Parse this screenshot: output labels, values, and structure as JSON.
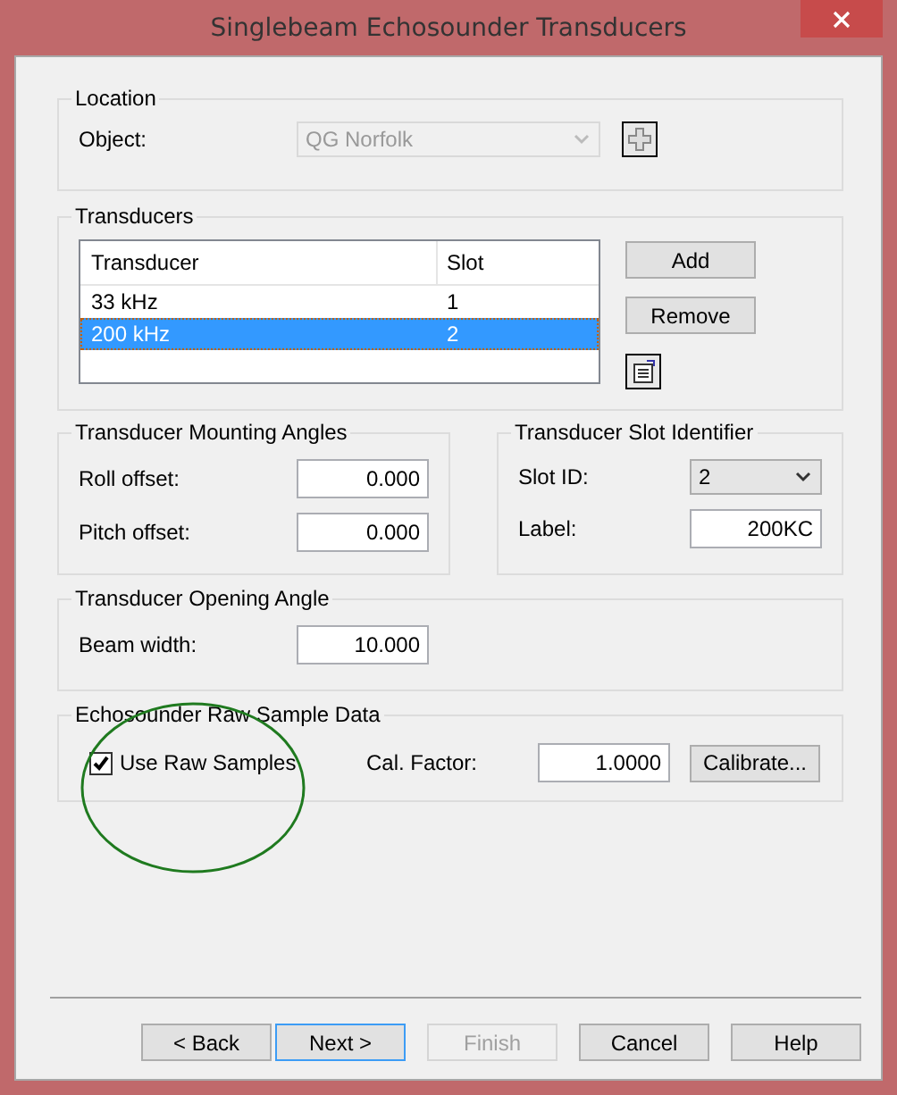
{
  "window": {
    "title": "Singlebeam Echosounder Transducers"
  },
  "location": {
    "title": "Location",
    "label": "Object:",
    "value": "QG Norfolk",
    "disabled": true
  },
  "transducers": {
    "title": "Transducers",
    "columns": [
      "Transducer",
      "Slot"
    ],
    "rows": [
      {
        "cells": [
          "33 kHz",
          "1"
        ],
        "selected": false
      },
      {
        "cells": [
          "200 kHz",
          "2"
        ],
        "selected": true
      }
    ],
    "buttons": [
      "Add",
      "Remove"
    ]
  },
  "mounting": {
    "title": "Transducer Mounting Angles",
    "fields": [
      {
        "kind": "text",
        "label": "Roll offset:",
        "value": "0.000"
      },
      {
        "kind": "text",
        "label": "Pitch offset:",
        "value": "0.000"
      }
    ]
  },
  "slot_identifier": {
    "title": "Transducer Slot Identifier",
    "fields": [
      {
        "kind": "dropdown",
        "label": "Slot ID:",
        "value": "2"
      },
      {
        "kind": "text",
        "label": "Label:",
        "value": "200KC"
      }
    ]
  },
  "opening": {
    "title": "Transducer Opening Angle",
    "fields": [
      {
        "kind": "text",
        "label": "Beam width:",
        "value": "10.000"
      }
    ]
  },
  "raw": {
    "title": "Echosounder Raw Sample Data",
    "checkbox": {
      "label": "Use Raw Samples",
      "checked": true
    },
    "cal_label": "Cal. Factor:",
    "cal_value": "1.0000",
    "calibrate": "Calibrate..."
  },
  "buttons": [
    {
      "label": "< Back",
      "default": false,
      "disabled": false
    },
    {
      "label": "Next >",
      "default": true,
      "disabled": false
    },
    {
      "label": "Finish",
      "default": false,
      "disabled": true
    },
    {
      "label": "Cancel",
      "default": false,
      "disabled": false
    },
    {
      "label": "Help",
      "default": false,
      "disabled": false
    }
  ]
}
